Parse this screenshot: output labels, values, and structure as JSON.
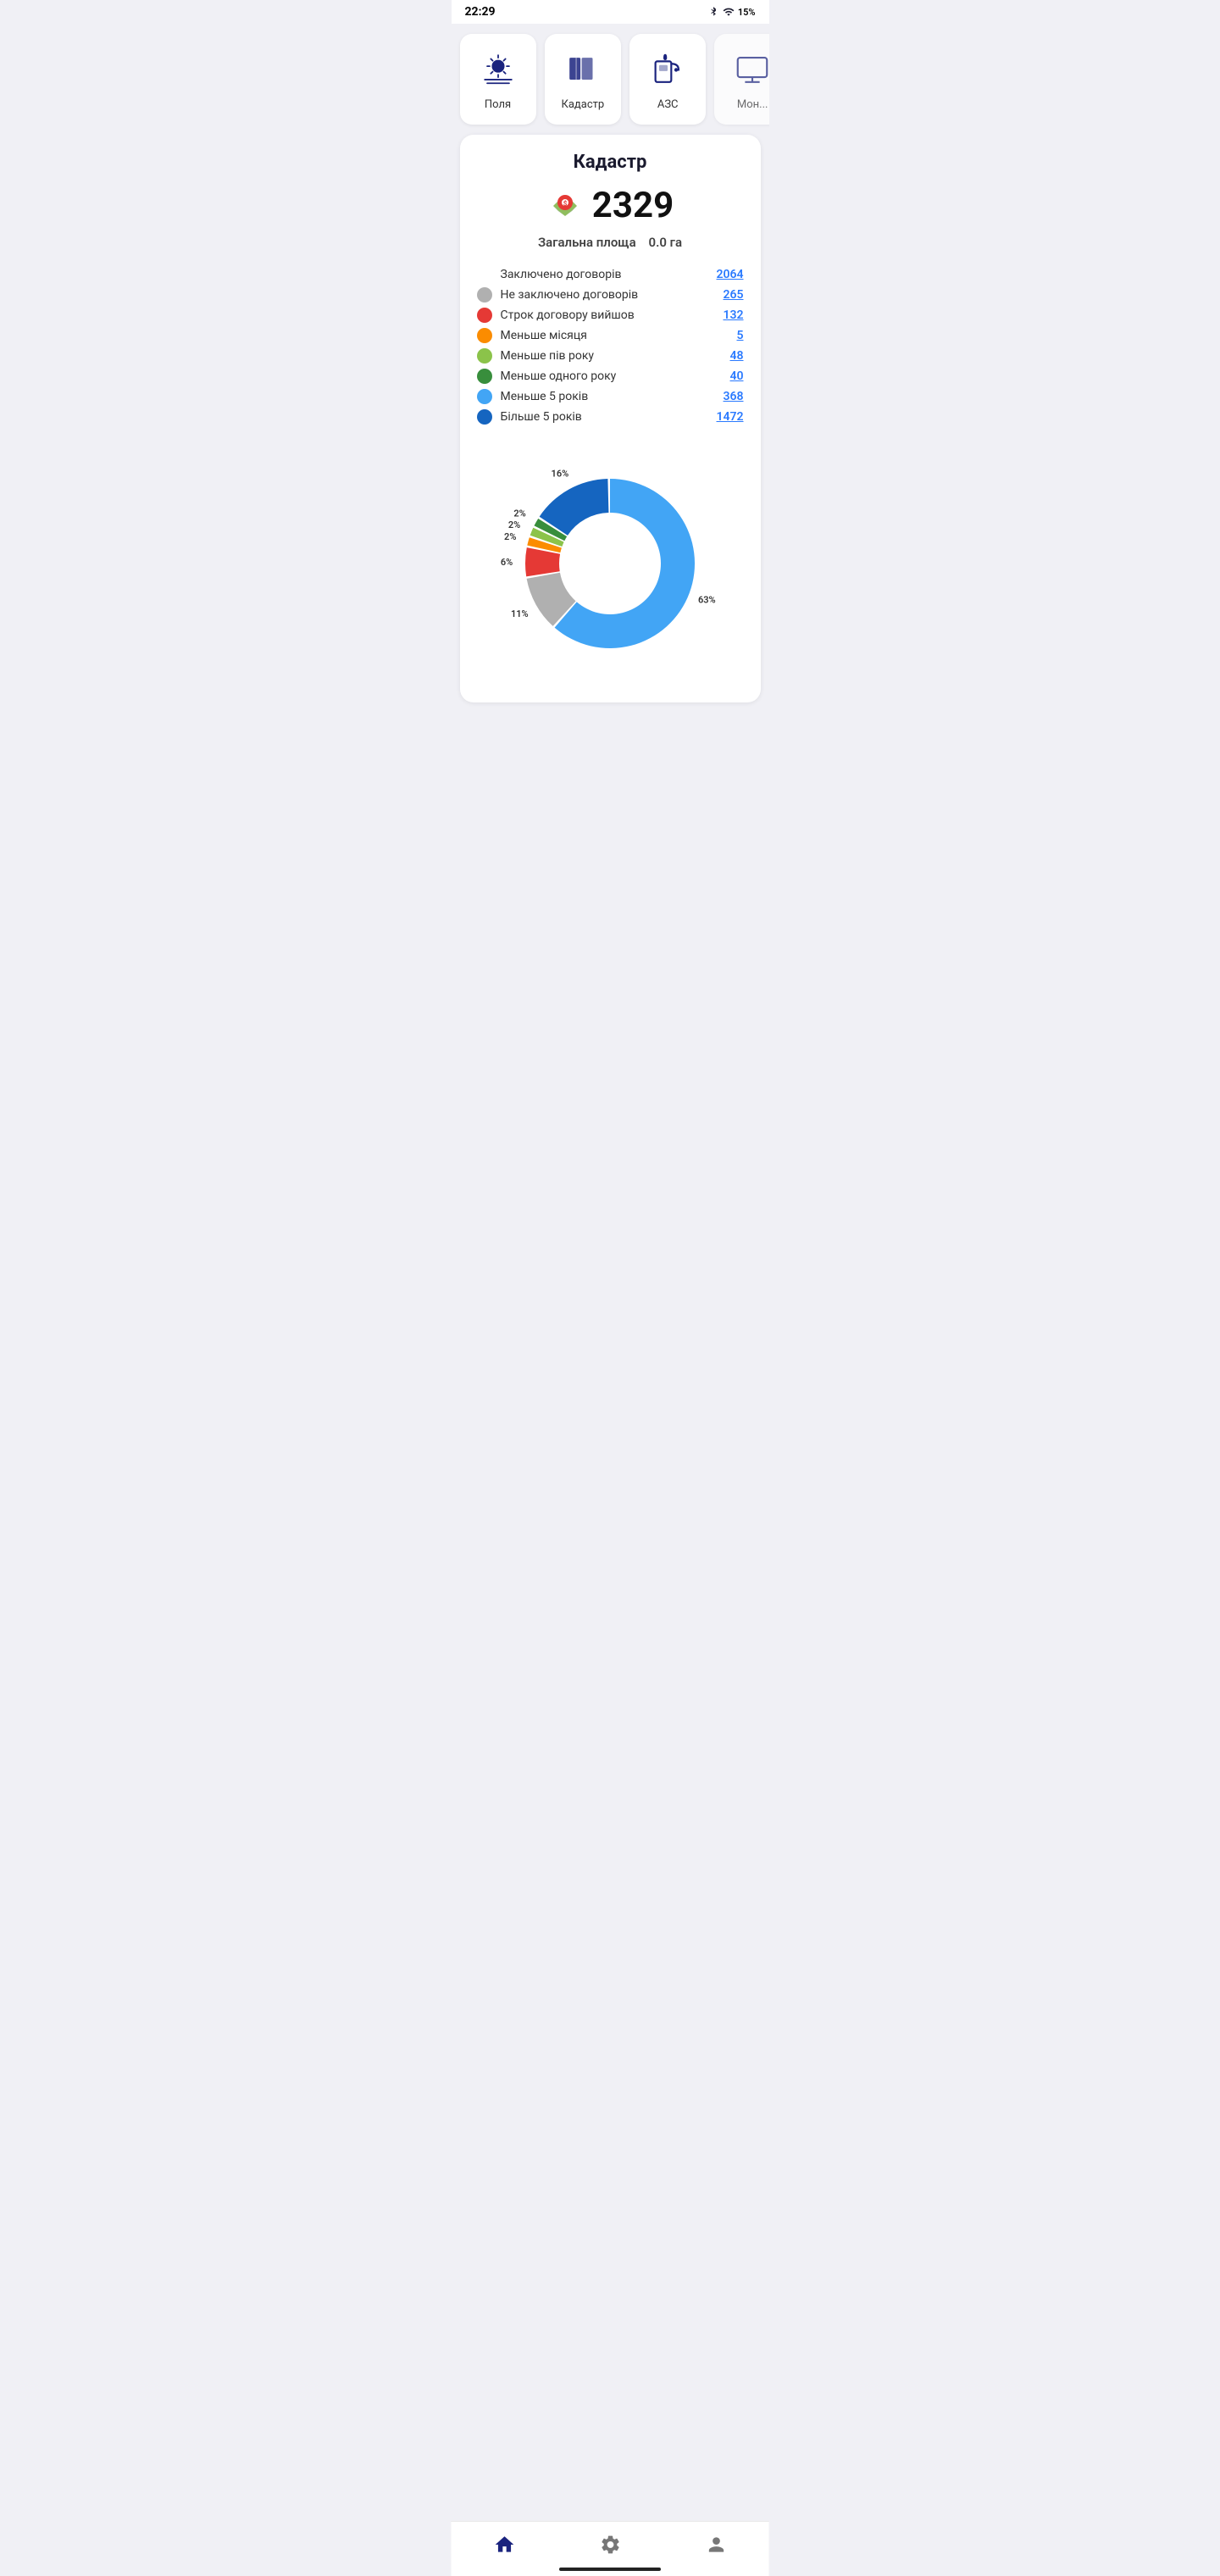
{
  "statusBar": {
    "time": "22:29",
    "batteryPercent": "15%"
  },
  "navCards": [
    {
      "id": "fields",
      "label": "Поля",
      "icon": "sun"
    },
    {
      "id": "cadastre",
      "label": "Кадастр",
      "icon": "map"
    },
    {
      "id": "gas",
      "label": "АЗС",
      "icon": "fuel"
    },
    {
      "id": "monitor",
      "label": "Мон...",
      "icon": "monitor"
    }
  ],
  "mainCard": {
    "title": "Кадастр",
    "count": "2329",
    "totalAreaLabel": "Загальна площа",
    "totalAreaValue": "0.0 га",
    "stats": [
      {
        "id": "concluded",
        "dot": null,
        "label": "Заключено договорів",
        "value": "2064",
        "dotColor": ""
      },
      {
        "id": "not_concluded",
        "dot": "#b0b0b0",
        "label": "Не заключено договорів",
        "value": "265",
        "dotColor": "#b0b0b0"
      },
      {
        "id": "expired",
        "dot": "#e53935",
        "label": "Строк договору вийшов",
        "value": "132",
        "dotColor": "#e53935"
      },
      {
        "id": "less_month",
        "dot": "#fb8c00",
        "label": "Меньше місяця",
        "value": "5",
        "dotColor": "#fb8c00"
      },
      {
        "id": "less_halfyear",
        "dot": "#8bc34a",
        "label": "Меньше пів року",
        "value": "48",
        "dotColor": "#8bc34a"
      },
      {
        "id": "less_year",
        "dot": "#388e3c",
        "label": "Меньше одного року",
        "value": "40",
        "dotColor": "#388e3c"
      },
      {
        "id": "less_5years",
        "dot": "#42a5f5",
        "label": "Меньше 5 років",
        "value": "368",
        "dotColor": "#42a5f5"
      },
      {
        "id": "more_5years",
        "dot": "#1565c0",
        "label": "Більше 5 років",
        "value": "1472",
        "dotColor": "#1565c0"
      }
    ],
    "chart": {
      "segments": [
        {
          "label": "63%",
          "value": 63,
          "color": "#42a5f5",
          "id": "less5"
        },
        {
          "label": "11%",
          "value": 11,
          "color": "#b0b0b0",
          "id": "not_concluded"
        },
        {
          "label": "6%",
          "value": 6,
          "color": "#e53935",
          "id": "expired"
        },
        {
          "label": "2%",
          "value": 2,
          "color": "#fb8c00",
          "id": "less_month"
        },
        {
          "label": "2%",
          "value": 2,
          "color": "#8bc34a",
          "id": "less_halfyear"
        },
        {
          "label": "2%",
          "value": 2,
          "color": "#388e3c",
          "id": "less_year"
        },
        {
          "label": "16%",
          "value": 16,
          "color": "#1565c0",
          "id": "more5"
        }
      ]
    }
  },
  "bottomNav": [
    {
      "id": "home",
      "label": "Home",
      "icon": "home"
    },
    {
      "id": "settings",
      "label": "Settings",
      "icon": "settings"
    },
    {
      "id": "profile",
      "label": "Profile",
      "icon": "person"
    }
  ]
}
